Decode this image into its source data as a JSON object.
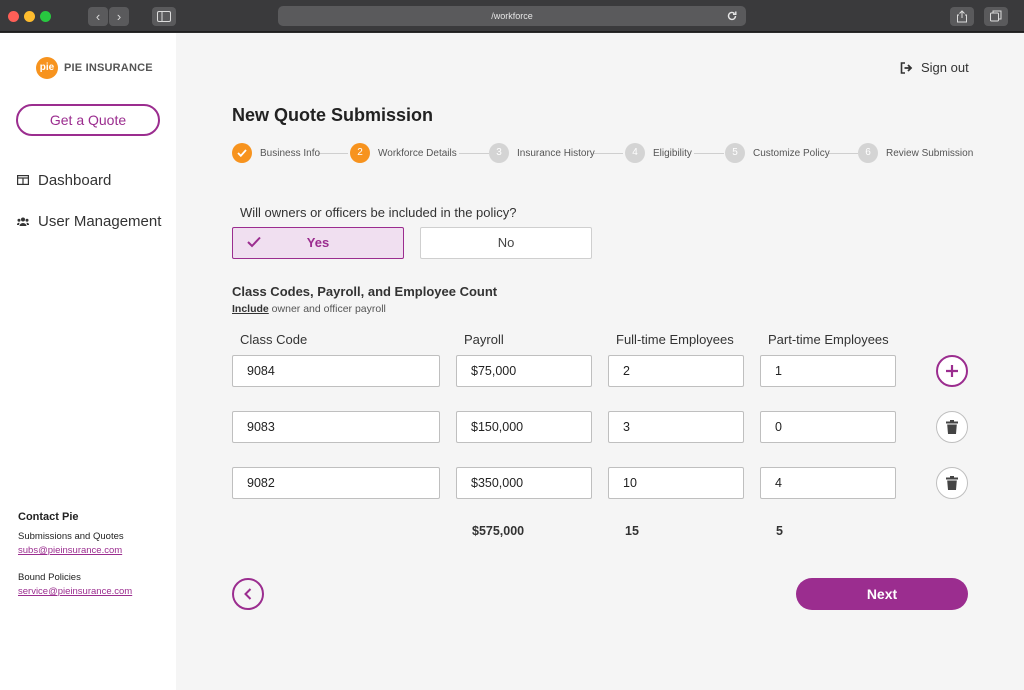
{
  "browser": {
    "url": "/workforce"
  },
  "brand": {
    "logo_badge": "pie",
    "name": "PIE INSURANCE",
    "accent": "#9b2d8f",
    "orange": "#f7931e"
  },
  "sidebar": {
    "quote_button": "Get a Quote",
    "items": [
      {
        "label": "Dashboard",
        "icon": "dashboard-icon"
      },
      {
        "label": "User Management",
        "icon": "users-icon"
      }
    ],
    "contact": {
      "title": "Contact Pie",
      "submissions_label": "Submissions and Quotes",
      "submissions_email": "subs@pieinsurance.com",
      "bound_label": "Bound Policies",
      "bound_email": "service@pieinsurance.com"
    }
  },
  "header": {
    "signout": "Sign out"
  },
  "page": {
    "title": "New Quote Submission"
  },
  "stepper": {
    "steps": [
      {
        "num": "1",
        "label": "Business Info",
        "state": "done"
      },
      {
        "num": "2",
        "label": "Workforce Details",
        "state": "active"
      },
      {
        "num": "3",
        "label": "Insurance History",
        "state": "pending"
      },
      {
        "num": "4",
        "label": "Eligibility",
        "state": "pending"
      },
      {
        "num": "5",
        "label": "Customize Policy",
        "state": "pending"
      },
      {
        "num": "6",
        "label": "Review Submission",
        "state": "pending"
      }
    ]
  },
  "owners": {
    "question": "Will owners or officers be included in the policy?",
    "yes": "Yes",
    "no": "No",
    "selected": "Yes"
  },
  "classcodes": {
    "title": "Class Codes, Payroll, and Employee Count",
    "sub_bold": "Include",
    "sub_rest": " owner and officer payroll",
    "headers": [
      "Class Code",
      "Payroll",
      "Full-time Employees",
      "Part-time Employees"
    ],
    "rows": [
      {
        "code": "9084",
        "payroll": "$75,000",
        "fulltime": "2",
        "parttime": "1"
      },
      {
        "code": "9083",
        "payroll": "$150,000",
        "fulltime": "3",
        "parttime": "0"
      },
      {
        "code": "9082",
        "payroll": "$350,000",
        "fulltime": "10",
        "parttime": "4"
      }
    ],
    "totals": {
      "payroll": "$575,000",
      "fulltime": "15",
      "parttime": "5"
    }
  },
  "footer": {
    "next": "Next"
  }
}
